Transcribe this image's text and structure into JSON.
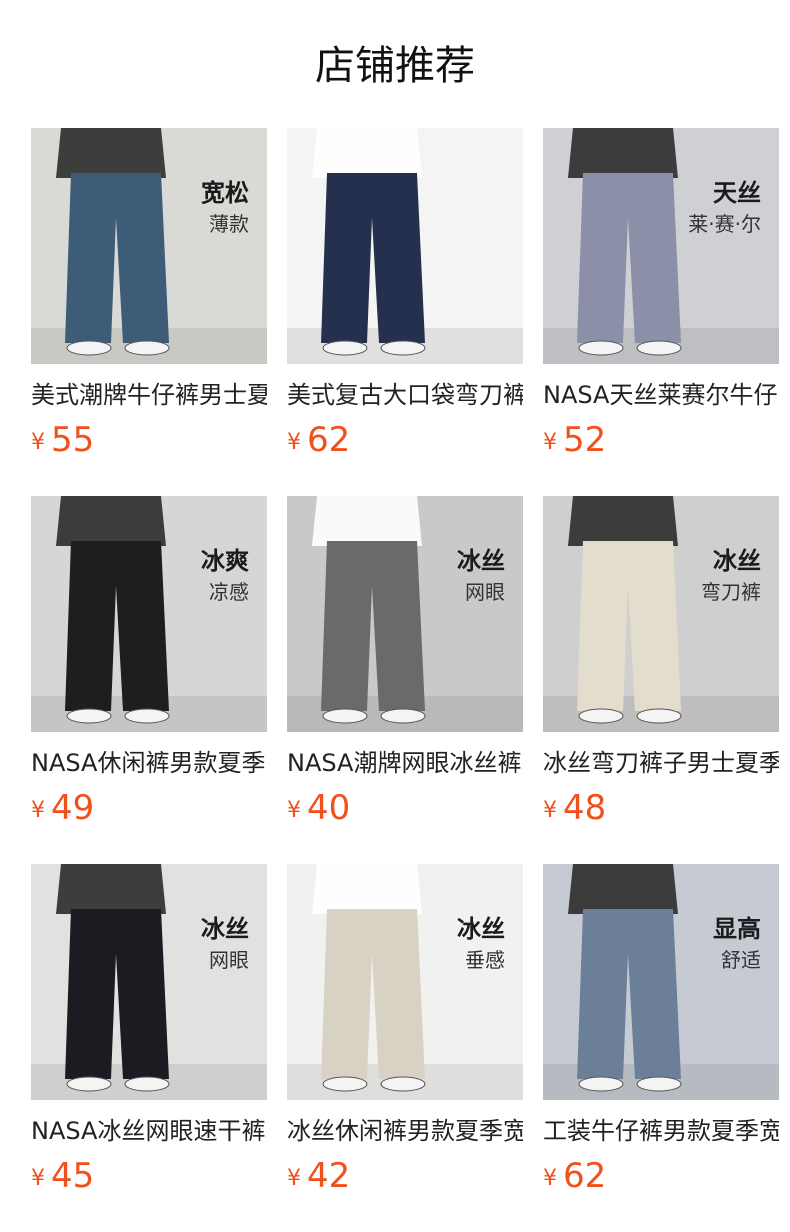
{
  "header": {
    "title": "店铺推荐"
  },
  "currency_symbol": "¥",
  "products": [
    {
      "name": "美式潮牌牛仔裤男士夏",
      "price": "55",
      "tag_main": "宽松",
      "tag_sub": "薄款",
      "bg": "#d9d9d6",
      "pants": "#3d5c78"
    },
    {
      "name": "美式复古大口袋弯刀裤",
      "price": "62",
      "tag_main": "",
      "tag_sub": "",
      "bg": "#f4f4f2",
      "pants": "#25304f"
    },
    {
      "name": "NASA天丝莱赛尔牛仔",
      "price": "52",
      "tag_main": "天丝",
      "tag_sub": "莱·赛·尔",
      "bg": "#cfd0d3",
      "pants": "#8b8fa8"
    },
    {
      "name": "NASA休闲裤男款夏季",
      "price": "49",
      "tag_main": "冰爽",
      "tag_sub": "凉感",
      "bg": "#d6d6d4",
      "pants": "#1e1e1e"
    },
    {
      "name": "NASA潮牌网眼冰丝裤",
      "price": "40",
      "tag_main": "冰丝",
      "tag_sub": "网眼",
      "bg": "#c9c9c9",
      "pants": "#6a6a6a"
    },
    {
      "name": "冰丝弯刀裤子男士夏季",
      "price": "48",
      "tag_main": "冰丝",
      "tag_sub": "弯刀裤",
      "bg": "#cfcfcf",
      "pants": "#e3ddcd"
    },
    {
      "name": "NASA冰丝网眼速干裤",
      "price": "45",
      "tag_main": "冰丝",
      "tag_sub": "网眼",
      "bg": "#e1e1df",
      "pants": "#1a1c22"
    },
    {
      "name": "冰丝休闲裤男款夏季宽",
      "price": "42",
      "tag_main": "冰丝",
      "tag_sub": "垂感",
      "bg": "#f1f1ef",
      "pants": "#d8d2c4"
    },
    {
      "name": "工装牛仔裤男款夏季宽",
      "price": "62",
      "tag_main": "显高",
      "tag_sub": "舒适",
      "bg": "#c6cbd3",
      "pants": "#6c7f99"
    }
  ]
}
